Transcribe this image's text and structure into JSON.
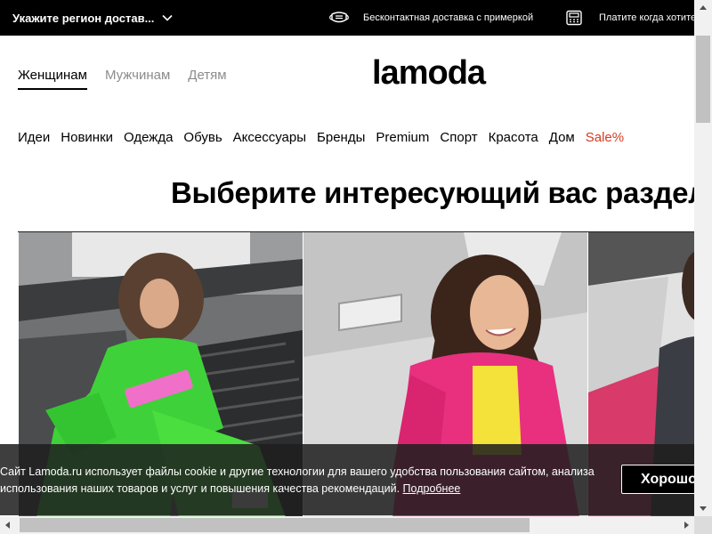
{
  "topbar": {
    "region_label": "Укажите регион достав...",
    "promos": [
      {
        "icon": "mask-icon",
        "text": "Бесконтактная доставка с примеркой"
      },
      {
        "icon": "payment-terminal-icon",
        "text": "Платите когда хотите"
      }
    ]
  },
  "gender_tabs": [
    {
      "label": "Женщинам",
      "active": true
    },
    {
      "label": "Мужчинам",
      "active": false
    },
    {
      "label": "Детям",
      "active": false
    }
  ],
  "logo": {
    "text": "lamoda"
  },
  "categories": [
    "Идеи",
    "Новинки",
    "Одежда",
    "Обувь",
    "Аксессуары",
    "Бренды",
    "Premium",
    "Спорт",
    "Красота",
    "Дом",
    "Sale%"
  ],
  "section_title": "Выберите интересующий вас раздел",
  "tiles": [
    {
      "name": "women-section"
    },
    {
      "name": "kids-section"
    },
    {
      "name": "men-section"
    }
  ],
  "cookie": {
    "text": "Сайт Lamoda.ru использует файлы cookie и другие технологии для вашего удобства пользования сайтом, анализа использования наших товаров и услуг и повышения качества рекомендаций.",
    "link": "Подробнее",
    "button": "Хорошо"
  },
  "colors": {
    "topbar_bg": "#000000",
    "sale": "#d63a1f",
    "inactive_tab": "#8c8c8c"
  }
}
